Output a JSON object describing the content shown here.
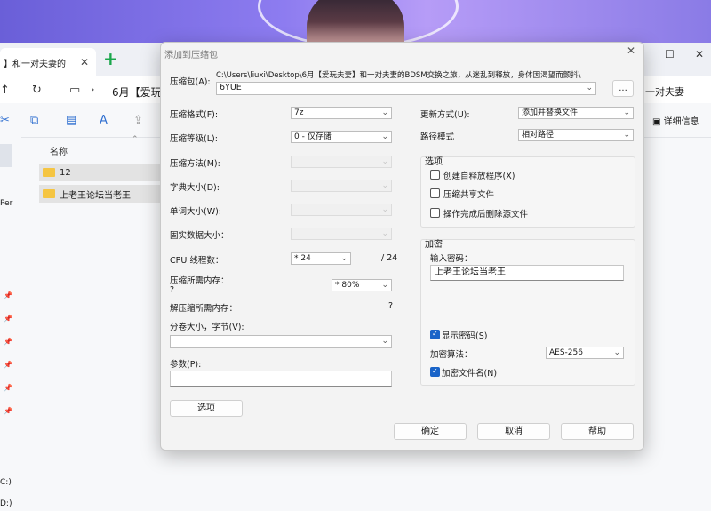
{
  "explorer": {
    "tab_title": "】和一对夫妻的",
    "address_path": "6月【爱玩",
    "address_tail": "一对夫妻",
    "details_label": "详细信息",
    "column_name": "名称",
    "files": [
      "12",
      "上老王论坛当老王"
    ],
    "sidebar_texts": [
      "Per",
      "C:)",
      "D:)"
    ]
  },
  "dialog": {
    "title": "添加到压缩包",
    "archive_label": "压缩包(A):",
    "archive_path": "C:\\Users\\liuxi\\Desktop\\6月【爱玩夫妻】和一对夫妻的BDSM交换之旅，从迷乱到释放，身体因渴望而颤抖\\",
    "archive_name": "6YUE",
    "browse_label": "...",
    "left": {
      "format_label": "压缩格式(F):",
      "format_value": "7z",
      "level_label": "压缩等级(L):",
      "level_value": "0 - 仅存储",
      "method_label": "压缩方法(M):",
      "dict_label": "字典大小(D):",
      "word_label": "单词大小(W):",
      "solid_label": "固实数据大小：",
      "threads_label": "CPU 线程数：",
      "threads_value": "* 24",
      "threads_total": "/ 24",
      "mem_label": "压缩所需内存：",
      "mem_q": "?",
      "mem_value": "* 80%",
      "decomp_label": "解压缩所需内存：",
      "decomp_value": "?",
      "volume_label": "分卷大小，字节(V):",
      "params_label": "参数(P):",
      "options_button": "选项"
    },
    "right": {
      "update_label": "更新方式(U):",
      "update_value": "添加并替换文件",
      "path_label": "路径模式",
      "path_value": "相对路径",
      "options_title": "选项",
      "opt_sfx": "创建自释放程序(X)",
      "opt_shared": "压缩共享文件",
      "opt_delete": "操作完成后删除源文件",
      "enc_title": "加密",
      "pw_label": "输入密码：",
      "pw_value": "上老王论坛当老王",
      "show_pw": "显示密码(S)",
      "enc_method_label": "加密算法：",
      "enc_method_value": "AES-256",
      "enc_names": "加密文件名(N)"
    },
    "buttons": {
      "ok": "确定",
      "cancel": "取消",
      "help": "帮助"
    }
  }
}
